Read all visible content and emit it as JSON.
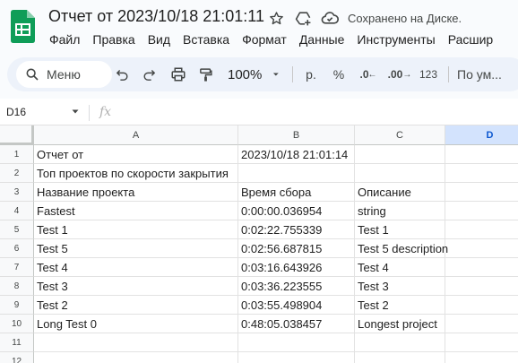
{
  "header": {
    "doc_title": "Отчет от 2023/10/18 21:01:11",
    "saved_status": "Сохранено на Диске.",
    "menu": [
      "Файл",
      "Правка",
      "Вид",
      "Вставка",
      "Формат",
      "Данные",
      "Инструменты",
      "Расшир"
    ]
  },
  "toolbar": {
    "search_label": "Меню",
    "zoom": "100%",
    "currency": "р.",
    "percent": "%",
    "dec_decrease": ".0",
    "dec_increase": ".00",
    "number_format": "123",
    "default_font": "По ум..."
  },
  "formula_bar": {
    "cell_ref": "D16",
    "fx_label": "fx"
  },
  "grid": {
    "columns": [
      "A",
      "B",
      "C",
      "D"
    ],
    "selected_column": "D",
    "rows": [
      {
        "n": "1",
        "a": "Отчет от",
        "b": "2023/10/18 21:01:14",
        "c": ""
      },
      {
        "n": "2",
        "a": "Топ проектов по скорости закрытия",
        "b": "",
        "c": ""
      },
      {
        "n": "3",
        "a": "Название проекта",
        "b": "Время сбора",
        "c": "Описание"
      },
      {
        "n": "4",
        "a": "Fastest",
        "b": "0:00:00.036954",
        "c": "string"
      },
      {
        "n": "5",
        "a": "Test 1",
        "b": "0:02:22.755339",
        "c": "Test 1"
      },
      {
        "n": "6",
        "a": "Test 5",
        "b": "0:02:56.687815",
        "c": "Test 5 description"
      },
      {
        "n": "7",
        "a": "Test 4",
        "b": "0:03:16.643926",
        "c": "Test 4"
      },
      {
        "n": "8",
        "a": "Test 3",
        "b": "0:03:36.223555",
        "c": "Test 3"
      },
      {
        "n": "9",
        "a": "Test 2",
        "b": "0:03:55.498904",
        "c": "Test 2"
      },
      {
        "n": "10",
        "a": "Long Test 0",
        "b": "0:48:05.038457",
        "c": "Longest project"
      },
      {
        "n": "11",
        "a": "",
        "b": "",
        "c": ""
      },
      {
        "n": "12",
        "a": "",
        "b": "",
        "c": ""
      }
    ]
  },
  "colors": {
    "sheets_green": "#0f9d58",
    "selected_header_bg": "#d3e3fd",
    "selected_header_text": "#0b57d0"
  }
}
